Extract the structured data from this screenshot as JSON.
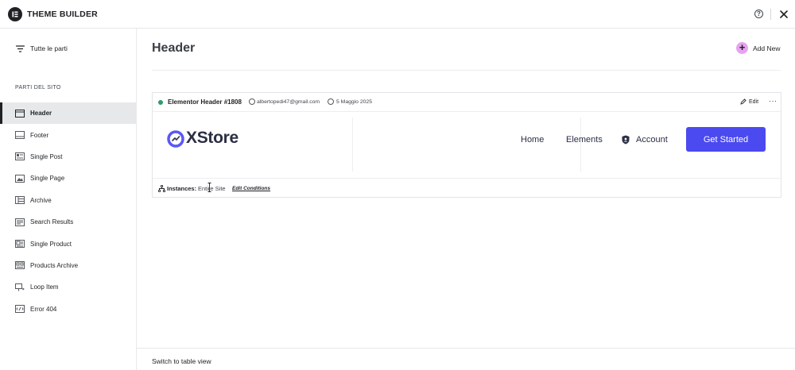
{
  "app": {
    "title": "THEME BUILDER"
  },
  "sidebar": {
    "all_parts_label": "Tutte le parti",
    "section_title": "PARTI DEL SITO",
    "items": [
      {
        "label": "Header",
        "icon": "header-icon",
        "active": true
      },
      {
        "label": "Footer",
        "icon": "footer-icon"
      },
      {
        "label": "Single Post",
        "icon": "single-post-icon"
      },
      {
        "label": "Single Page",
        "icon": "single-page-icon"
      },
      {
        "label": "Archive",
        "icon": "archive-icon"
      },
      {
        "label": "Search Results",
        "icon": "search-results-icon"
      },
      {
        "label": "Single Product",
        "icon": "single-product-icon"
      },
      {
        "label": "Products Archive",
        "icon": "products-archive-icon"
      },
      {
        "label": "Loop Item",
        "icon": "loop-item-icon"
      },
      {
        "label": "Error 404",
        "icon": "error-404-icon"
      }
    ]
  },
  "main": {
    "title": "Header",
    "add_new_label": "Add New"
  },
  "card": {
    "name": "Elementor Header #1808",
    "author_email": "albertopedi47@gmail.com",
    "date": "5 Maggio 2025",
    "edit_label": "Edit",
    "more_label": "···",
    "preview": {
      "logo_text": "XStore",
      "nav": [
        "Home",
        "Elements"
      ],
      "account_label": "Account",
      "cta_label": "Get Started"
    },
    "instances_label": "Instances:",
    "instances_value": "Entire Site",
    "edit_conditions_label": "Edit Conditions"
  },
  "footer": {
    "switch_view_label": "Switch to table view"
  },
  "colors": {
    "accent_add": "#e7a3f0",
    "cta": "#4b49f0",
    "status": "#2d9c6a",
    "active_nav_bg": "#e6e8ea"
  }
}
